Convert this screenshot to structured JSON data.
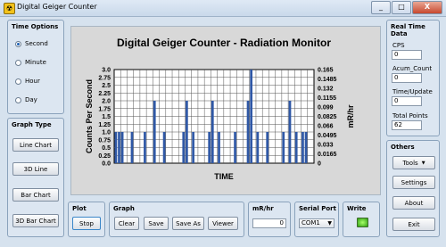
{
  "window": {
    "title": "Digital Geiger Counter",
    "app_icon": "radiation-icon",
    "controls": [
      "_",
      "□",
      "X"
    ]
  },
  "time_options": {
    "title": "Time Options",
    "options": [
      "Second",
      "Minute",
      "Hour",
      "Day"
    ],
    "selected": "Second"
  },
  "graph_type": {
    "title": "Graph Type",
    "buttons": [
      "Line Chart",
      "3D Line",
      "Bar Chart",
      "3D Bar Chart"
    ]
  },
  "plot": {
    "title": "Plot",
    "stop_label": "Stop"
  },
  "graph": {
    "title": "Graph",
    "buttons": [
      "Clear",
      "Save",
      "Save As",
      "Viewer"
    ]
  },
  "mr_hr": {
    "title": "mR/hr",
    "value": "0"
  },
  "serial_port": {
    "title": "Serial Port",
    "value": "COM1"
  },
  "write": {
    "title": "Write",
    "led_color": "#3cc21b"
  },
  "real_time_data": {
    "title": "Real Time Data",
    "cps_label": "CPS",
    "cps_value": "0",
    "acum_label": "Acum_Count",
    "acum_value": "0",
    "time_label": "Time/Update",
    "time_value": "0",
    "total_label": "Total Points",
    "total_value": "62"
  },
  "others": {
    "title": "Others",
    "tools_label": "Tools",
    "settings_label": "Settings",
    "about_label": "About",
    "exit_label": "Exit"
  },
  "chart_data": {
    "type": "bar",
    "title": "Digital Geiger Counter - Radiation Monitor",
    "xlabel": "TIME",
    "ylabel": "Counts Per Second",
    "y2label": "mR/hr",
    "ylim": [
      0,
      3.0
    ],
    "y_ticks": [
      "0.0",
      "0.25",
      "0.5",
      "0.75",
      "1.0",
      "1.25",
      "1.5",
      "1.75",
      "2.0",
      "2.25",
      "2.5",
      "2.75",
      "3.0"
    ],
    "y2_ticks": [
      "0",
      "0.0165",
      "0.033",
      "0.0495",
      "0.066",
      "0.0825",
      "0.099",
      "0.1155",
      "0.132",
      "0.1485",
      "0.165"
    ],
    "bar_color": "#2f58a6",
    "grid": true,
    "x": [
      1,
      2,
      3,
      6,
      10,
      13,
      16,
      22,
      23,
      25,
      30,
      31,
      33,
      38,
      42,
      43,
      45,
      48,
      53,
      55,
      57,
      59,
      60
    ],
    "values": [
      1,
      1,
      1,
      1,
      1,
      2,
      1,
      1,
      2,
      1,
      1,
      2,
      1,
      1,
      2,
      3,
      1,
      1,
      1,
      2,
      1,
      1,
      1
    ]
  }
}
